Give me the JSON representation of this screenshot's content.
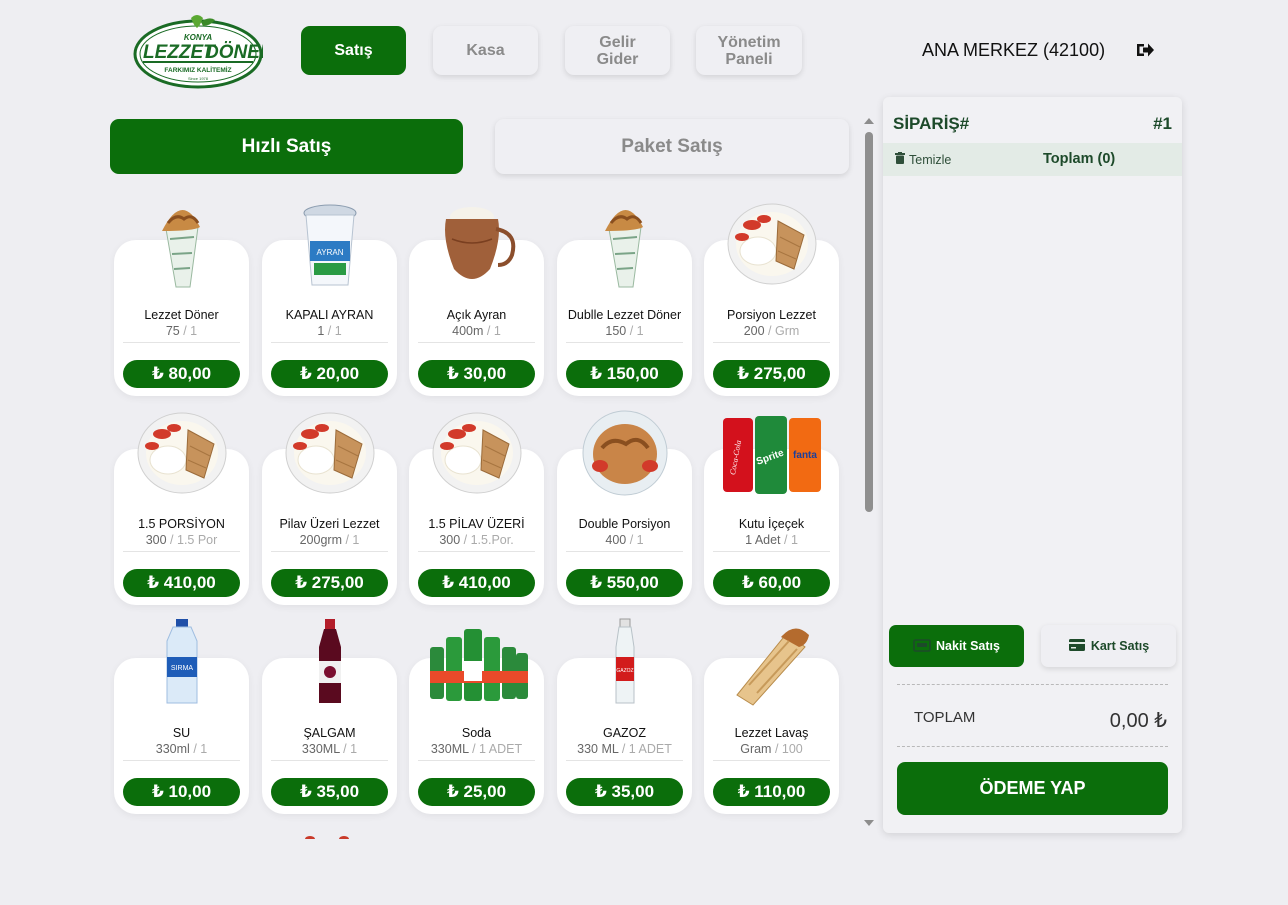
{
  "brand": {
    "logo_top": "KONYA",
    "logo_name_1": "LEZZET",
    "logo_name_2": "DÖNER",
    "logo_tagline": "FARKIMIZ KALİTEMİZ",
    "logo_since": "Since 1978"
  },
  "nav": {
    "items": [
      {
        "label": "Satış"
      },
      {
        "label": "Kasa"
      },
      {
        "label": "Gelir Gider"
      },
      {
        "label": "Yönetim Paneli"
      }
    ]
  },
  "branch": "ANA MERKEZ (42100)",
  "sale_tabs": [
    {
      "label": "Hızlı Satış"
    },
    {
      "label": "Paket Satış"
    }
  ],
  "products": [
    {
      "name": "Lezzet Döner",
      "amount": "75",
      "unit": "/ 1",
      "price": "₺ 80,00",
      "icon": "doner-wrap"
    },
    {
      "name": "KAPALI AYRAN",
      "amount": "1",
      "unit": "/ 1",
      "price": "₺ 20,00",
      "icon": "ayran-cup"
    },
    {
      "name": "Açık Ayran",
      "amount": "400m",
      "unit": "/ 1",
      "price": "₺ 30,00",
      "icon": "copper-jug"
    },
    {
      "name": "Dubl­le Lezzet Döner",
      "amount": "150",
      "unit": "/ 1",
      "price": "₺ 150,00",
      "icon": "doner-wrap"
    },
    {
      "name": "Porsiyon Lezzet",
      "amount": "200",
      "unit": "/ Grm",
      "price": "₺ 275,00",
      "icon": "plate-portion"
    },
    {
      "name": "1.5 PORSİYON",
      "amount": "300",
      "unit": "/ 1.5 Por",
      "price": "₺ 410,00",
      "icon": "plate-portion"
    },
    {
      "name": "Pilav Üzeri Lezzet",
      "amount": "200grm",
      "unit": "/ 1",
      "price": "₺ 275,00",
      "icon": "plate-portion"
    },
    {
      "name": "1.5 PİLAV ÜZERİ",
      "amount": "300",
      "unit": "/ 1.5.Por.",
      "price": "₺ 410,00",
      "icon": "plate-portion"
    },
    {
      "name": "Double Porsiyon",
      "amount": "400",
      "unit": "/ 1",
      "price": "₺ 550,00",
      "icon": "double-plate"
    },
    {
      "name": "Kutu İçeçek",
      "amount": "1 Adet",
      "unit": "/ 1",
      "price": "₺ 60,00",
      "icon": "soda-cans"
    },
    {
      "name": "SU",
      "amount": "330ml",
      "unit": "/ 1",
      "price": "₺ 10,00",
      "icon": "water-bottle"
    },
    {
      "name": "ŞALGAM",
      "amount": "330ML",
      "unit": "/ 1",
      "price": "₺ 35,00",
      "icon": "salgam-bottle"
    },
    {
      "name": "Soda",
      "amount": "330ML",
      "unit": "/ 1 ADET",
      "price": "₺ 25,00",
      "icon": "soda-bottles"
    },
    {
      "name": "GAZOZ",
      "amount": "330 ML",
      "unit": "/ 1 ADET",
      "price": "₺ 35,00",
      "icon": "gazoz-bottle"
    },
    {
      "name": "Lezzet Lavaş",
      "amount": "Gram",
      "unit": "/ 100",
      "price": "₺ 110,00",
      "icon": "lavas-wrap"
    }
  ],
  "order": {
    "title": "SİPARİŞ#",
    "number": "#1",
    "clear_label": "Temizle",
    "total_count_label": "Toplam (0)",
    "cash_label": "Nakit Satış",
    "card_label": "Kart Satış",
    "total_label": "TOPLAM",
    "total_value": "0,00 ₺",
    "pay_label": "ÖDEME YAP"
  },
  "colors": {
    "brand_green": "#0b6e0b",
    "background": "#eeeef2",
    "panel_title": "#1d4a2a"
  }
}
